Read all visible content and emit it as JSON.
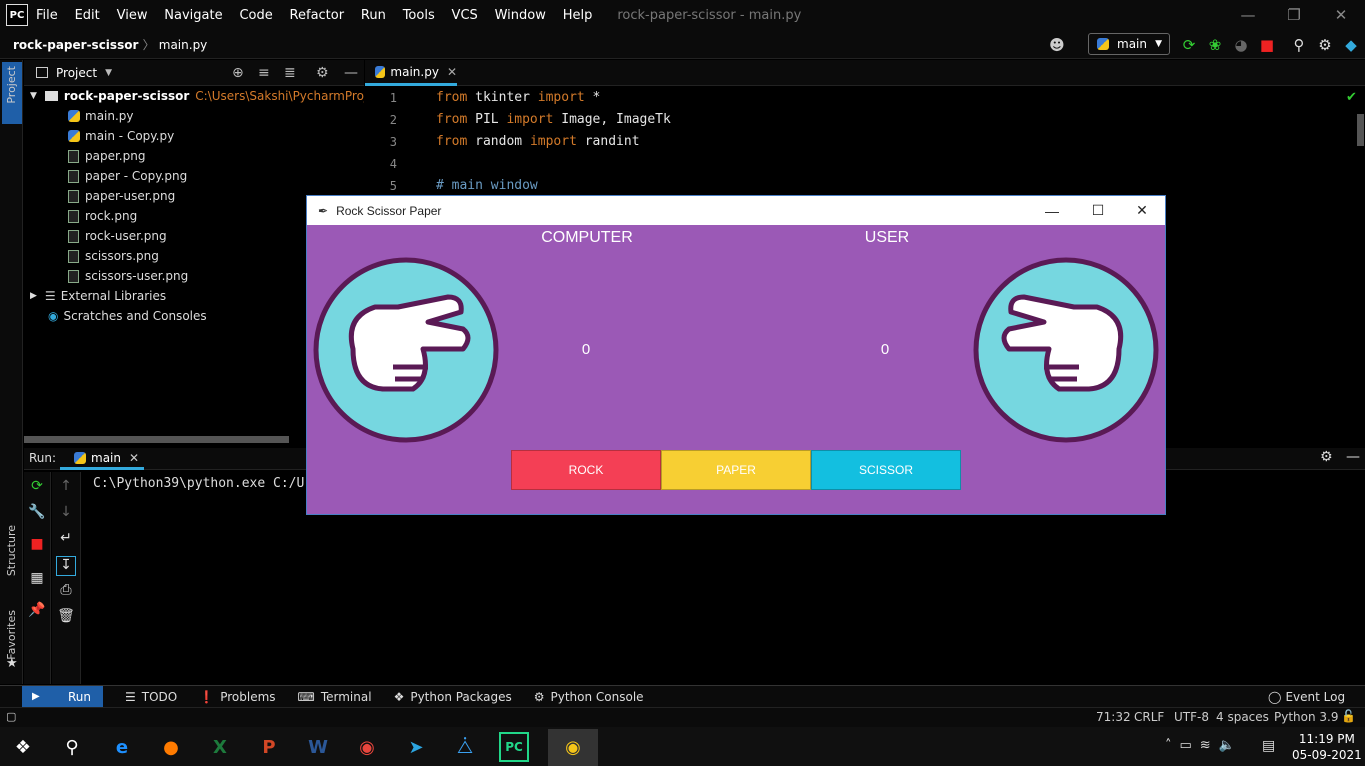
{
  "app": {
    "logo": "PC",
    "menu": [
      "File",
      "Edit",
      "View",
      "Navigate",
      "Code",
      "Refactor",
      "Run",
      "Tools",
      "VCS",
      "Window",
      "Help"
    ],
    "window_title": "rock-paper-scissor - main.py"
  },
  "nav": {
    "project": "rock-paper-scissor",
    "file": "main.py",
    "run_config": "main"
  },
  "project_panel": {
    "title": "Project",
    "root": "rock-paper-scissor",
    "root_path": "C:\\Users\\Sakshi\\PycharmProjects\\rc",
    "files": [
      "main.py",
      "main - Copy.py",
      "paper.png",
      "paper - Copy.png",
      "paper-user.png",
      "rock.png",
      "rock-user.png",
      "scissors.png",
      "scissors-user.png"
    ],
    "external": "External Libraries",
    "scratches": "Scratches and Consoles"
  },
  "left_strip": {
    "project": "Project",
    "structure": "Structure",
    "favorites": "Favorites"
  },
  "editor": {
    "tab": "main.py",
    "lines": [
      {
        "n": "1",
        "a": "from",
        "b": " tkinter ",
        "c": "import",
        "d": " *"
      },
      {
        "n": "2",
        "a": "from",
        "b": " PIL ",
        "c": "import",
        "d": " Image, ImageTk"
      },
      {
        "n": "3",
        "a": "from",
        "b": " random ",
        "c": "import",
        "d": " randint"
      },
      {
        "n": "4",
        "a": "",
        "b": "",
        "c": "",
        "d": ""
      },
      {
        "n": "5",
        "comment": "# main window"
      }
    ]
  },
  "run_panel": {
    "label": "Run:",
    "tab": "main",
    "console": "C:\\Python39\\python.exe C:/U"
  },
  "bottom_tabs": [
    "Run",
    "TODO",
    "Problems",
    "Terminal",
    "Python Packages",
    "Python Console"
  ],
  "event_log": "Event Log",
  "status": {
    "position": "71:32",
    "line_sep": "CRLF",
    "encoding": "UTF-8",
    "indent": "4 spaces",
    "interpreter": "Python 3.9"
  },
  "taskbar": {
    "time": "11:19 PM",
    "date": "05-09-2021"
  },
  "game": {
    "title": "Rock Scissor Paper",
    "computer_label": "COMPUTER",
    "user_label": "USER",
    "computer_score": "0",
    "user_score": "0",
    "buttons": [
      "ROCK",
      "PAPER",
      "SCISSOR"
    ],
    "colors": {
      "bg": "#9b59b6",
      "rock": "#f43f55",
      "paper": "#f7cf33",
      "scissor": "#13bfe0",
      "circle": "#76d7e0"
    }
  }
}
